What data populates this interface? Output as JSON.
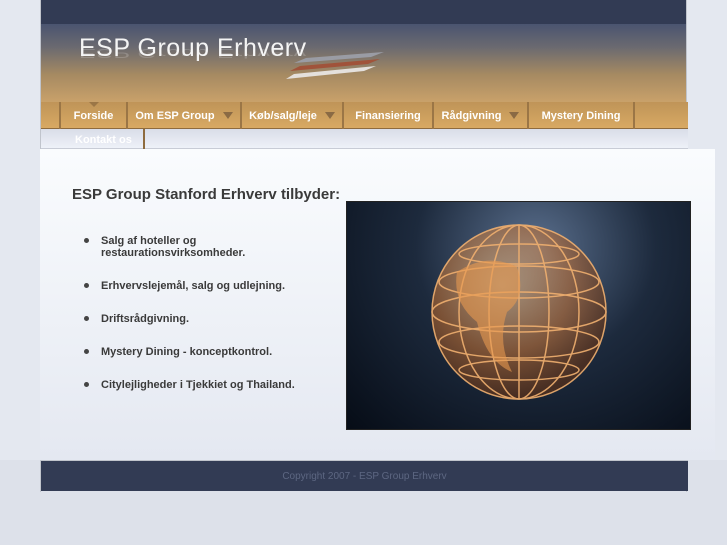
{
  "header": {
    "logo_text": "ESP Group Erhverv"
  },
  "nav": {
    "items": [
      {
        "label": "Forside",
        "dropdown": false,
        "active": true
      },
      {
        "label": "Om ESP Group",
        "dropdown": true
      },
      {
        "label": "Køb/salg/leje",
        "dropdown": true
      },
      {
        "label": "Finansiering",
        "dropdown": false
      },
      {
        "label": "Rådgivning",
        "dropdown": true
      },
      {
        "label": "Mystery Dining",
        "dropdown": false
      }
    ],
    "second_row": "Kontakt os"
  },
  "main": {
    "heading": "ESP Group Stanford Erhverv tilbyder:",
    "bullets": [
      "Salg af hoteller og restaurationsvirksomheder.",
      "Erhvervslejemål, salg og udlejning.",
      "Driftsrådgivning.",
      "Mystery Dining -  konceptkontrol.",
      "Citylejligheder i Tjekkiet og Thailand."
    ]
  },
  "footer": {
    "copyright": "Copyright 2007 - ESP Group Erhverv"
  },
  "colors": {
    "navy": "#323b54",
    "nav_tan": "#c99d5a"
  }
}
